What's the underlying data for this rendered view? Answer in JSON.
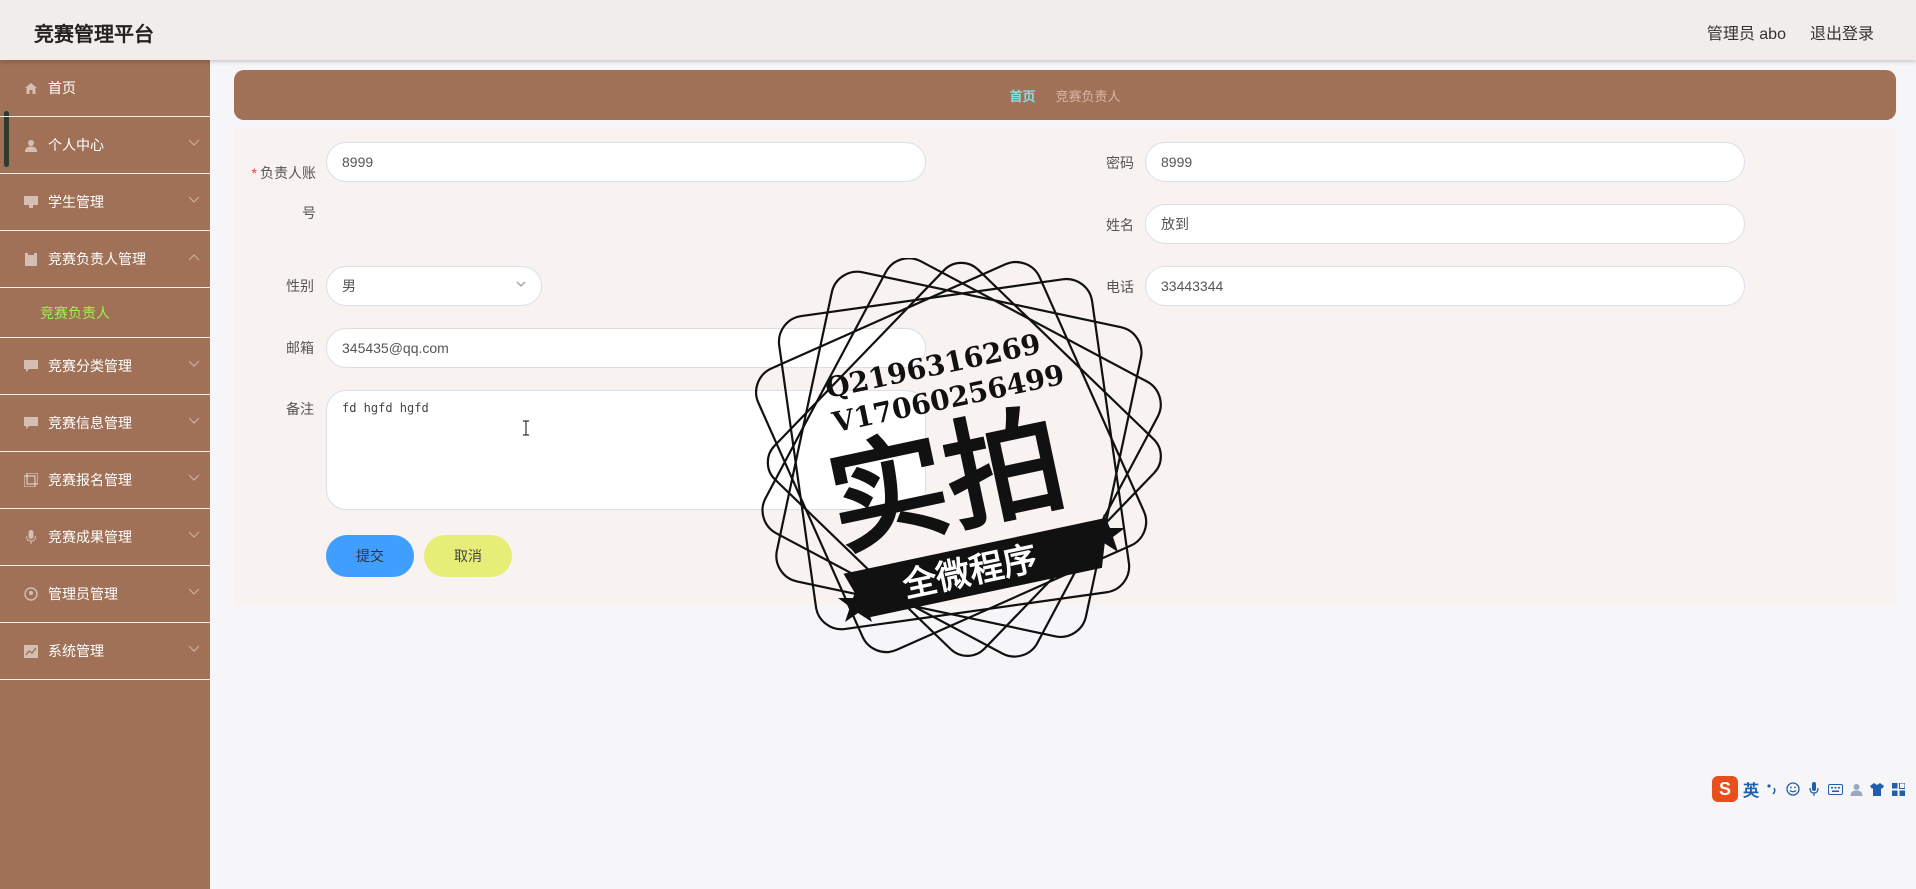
{
  "header": {
    "brand": "竞赛管理平台",
    "user_label": "管理员 abo",
    "logout_label": "退出登录"
  },
  "sidebar": {
    "items": [
      {
        "label": "首页",
        "icon": "home-icon"
      },
      {
        "label": "个人中心",
        "icon": "user-icon"
      },
      {
        "label": "学生管理",
        "icon": "monitor-icon"
      },
      {
        "label": "竞赛负责人管理",
        "icon": "clipboard-icon"
      },
      {
        "label": "竞赛负责人",
        "icon": ""
      },
      {
        "label": "竞赛分类管理",
        "icon": "chat-icon"
      },
      {
        "label": "竞赛信息管理",
        "icon": "message-icon"
      },
      {
        "label": "竞赛报名管理",
        "icon": "copy-icon"
      },
      {
        "label": "竞赛成果管理",
        "icon": "microphone-icon"
      },
      {
        "label": "管理员管理",
        "icon": "circle-user-icon"
      },
      {
        "label": "系统管理",
        "icon": "chart-icon"
      }
    ],
    "active_color": "#9df24c"
  },
  "breadcrumb": {
    "home": "首页",
    "separator": "",
    "current": "竞赛负责人"
  },
  "form": {
    "account_label": "负责人账号",
    "account_value": "8999",
    "password_label": "密码",
    "password_value": "8999",
    "name_label": "姓名",
    "name_value": "放到",
    "gender_label": "性别",
    "gender_value": "男",
    "phone_label": "电话",
    "phone_value": "33443344",
    "email_label": "邮箱",
    "email_value": "345435@qq.com",
    "remark_label": "备注",
    "remark_value": "fd hgfd hgfd",
    "submit_label": "提交",
    "cancel_label": "取消"
  },
  "watermark": {
    "contact_q": "Q2196316269",
    "contact_v": "V17060256499",
    "title": "实拍",
    "banner": "全微程序"
  },
  "ime": {
    "logo": "S",
    "lang": "英"
  },
  "colors": {
    "sidebar": "#a07156",
    "primary": "#409eff",
    "cancel": "#e6ee78",
    "breadcrumb_home": "#7fe0e8"
  }
}
